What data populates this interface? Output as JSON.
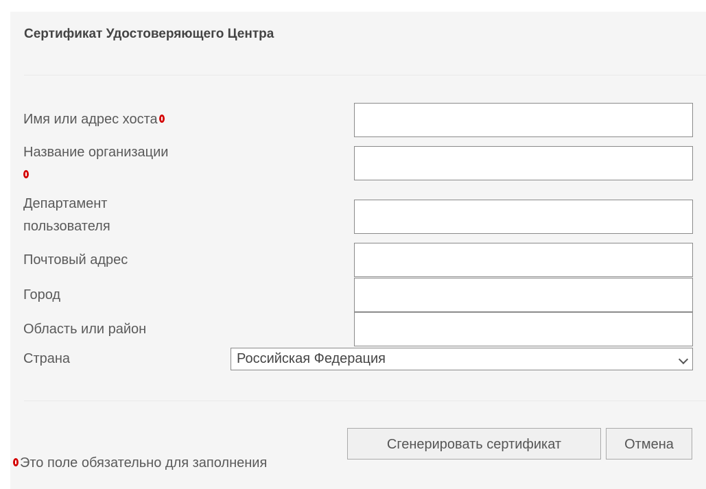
{
  "dialog": {
    "title": "Сертификат Удостоверяющего Центра"
  },
  "fields": [
    {
      "label": "Имя или адрес хоста",
      "required": true,
      "value": ""
    },
    {
      "label": "Название организации",
      "required": true,
      "value": ""
    },
    {
      "label": "Департамент пользователя",
      "required": false,
      "value": ""
    },
    {
      "label": "Почтовый адрес",
      "required": false,
      "value": ""
    },
    {
      "label": "Город",
      "required": false,
      "value": ""
    },
    {
      "label": "Область или район",
      "required": false,
      "value": ""
    }
  ],
  "country": {
    "label": "Страна",
    "selected": "Российская Федерация"
  },
  "buttons": {
    "generate": "Сгенерировать сертификат",
    "cancel": "Отмена"
  },
  "footnote": "Это поле обязательно для заполнения",
  "colors": {
    "required_marker": "#d40000",
    "dialog_background": "#f5f5f5"
  },
  "icons": {
    "required": "required-marker-icon",
    "dropdown": "chevron-down-icon"
  }
}
